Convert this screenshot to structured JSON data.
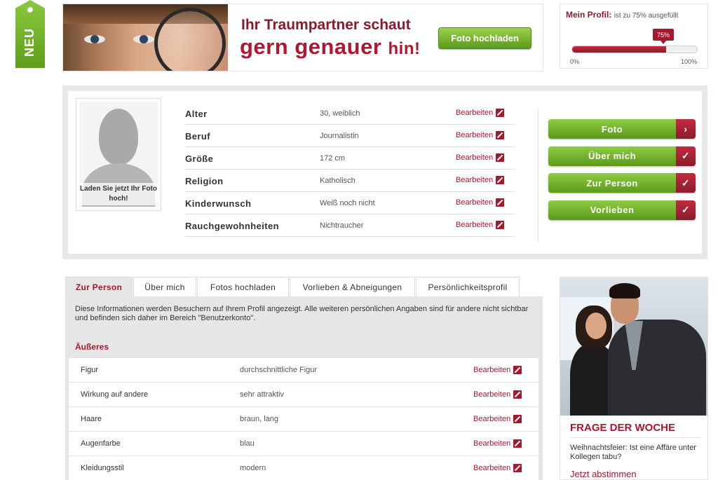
{
  "neu_tag": "NEU",
  "banner": {
    "title_line1": "Ihr Traumpartner schaut",
    "title_line2_main": "gern genauer",
    "title_line2_end": "hin!",
    "upload_button": "Foto hochladen"
  },
  "profile_status": {
    "label": "Mein Profil:",
    "text": "ist zu 75% ausgefüllt",
    "percent_label": "75%",
    "percent_value": 75,
    "scale_min": "0%",
    "scale_max": "100%"
  },
  "avatar": {
    "caption": "Laden Sie jetzt Ihr Foto hoch!"
  },
  "edit_label": "Bearbeiten",
  "basic_info": [
    {
      "key": "Alter",
      "value": "30, weiblich"
    },
    {
      "key": "Beruf",
      "value": "Journalistin"
    },
    {
      "key": "Größe",
      "value": "172 cm"
    },
    {
      "key": "Religion",
      "value": "Katholisch"
    },
    {
      "key": "Kinderwunsch",
      "value": "Weiß noch nicht"
    },
    {
      "key": "Rauchgewohnheiten",
      "value": "Nichtraucher"
    }
  ],
  "side_buttons": [
    {
      "label": "Foto",
      "icon": "chevron-right-icon",
      "glyph": "›"
    },
    {
      "label": "Über mich",
      "icon": "check-icon",
      "glyph": "✓"
    },
    {
      "label": "Zur Person",
      "icon": "check-icon",
      "glyph": "✓"
    },
    {
      "label": "Vorlieben",
      "icon": "check-icon",
      "glyph": "✓"
    }
  ],
  "tabs": [
    {
      "label": "Zur Person",
      "active": true
    },
    {
      "label": "Über mich",
      "active": false
    },
    {
      "label": "Fotos hochladen",
      "active": false
    },
    {
      "label": "Vorlieben & Abneigungen",
      "active": false
    },
    {
      "label": "Persönlichkeitsprofil",
      "active": false
    }
  ],
  "tab_content": {
    "description": "Diese Informationen werden Besuchern auf Ihrem Profil angezeigt. Alle weiteren persönlichen Angaben sind für andere nicht sichtbar und befinden sich daher im Bereich \"Benutzerkonto\".",
    "section_title": "Äußeres",
    "rows": [
      {
        "key": "Figur",
        "value": "durchschnittliche Figur"
      },
      {
        "key": "Wirkung auf andere",
        "value": "sehr attraktiv"
      },
      {
        "key": "Haare",
        "value": "braun, lang"
      },
      {
        "key": "Augenfarbe",
        "value": "blau"
      },
      {
        "key": "Kleidungsstil",
        "value": "modern"
      }
    ]
  },
  "question": {
    "title": "FRAGE DER WOCHE",
    "text": "Weihnachtsfeier: Ist eine Affäre unter Kollegen tabu?",
    "link": "Jetzt abstimmen"
  },
  "colors": {
    "accent_red": "#a8182d",
    "accent_green": "#6aab24"
  }
}
